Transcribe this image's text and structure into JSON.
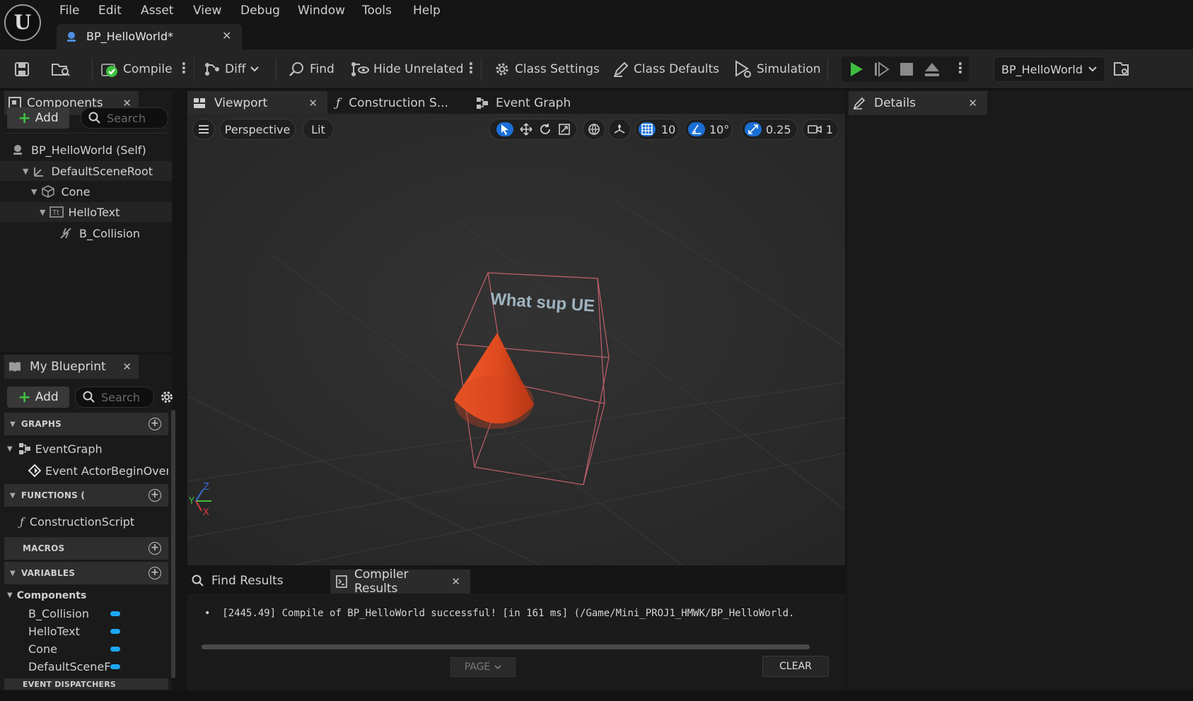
{
  "menu": {
    "items": [
      "File",
      "Edit",
      "Asset",
      "View",
      "Debug",
      "Window",
      "Tools",
      "Help"
    ]
  },
  "document_tab": {
    "title": "BP_HelloWorld*"
  },
  "toolbar": {
    "compile": "Compile",
    "diff": "Diff",
    "find": "Find",
    "hide_unrelated": "Hide Unrelated",
    "class_settings": "Class Settings",
    "class_defaults": "Class Defaults",
    "simulation": "Simulation",
    "debug_object": "BP_HelloWorld"
  },
  "components_panel": {
    "title": "Components",
    "add_label": "Add",
    "search_placeholder": "Search",
    "tree": [
      {
        "label": "BP_HelloWorld (Self)",
        "icon": "actor-icon"
      },
      {
        "label": "DefaultSceneRoot",
        "icon": "scene-root-icon"
      },
      {
        "label": "Cone",
        "icon": "mesh-icon"
      },
      {
        "label": "HelloText",
        "icon": "text-render-icon"
      },
      {
        "label": "B_Collision",
        "icon": "collision-icon"
      }
    ]
  },
  "my_blueprint": {
    "title": "My Blueprint",
    "add_label": "Add",
    "search_placeholder": "Search",
    "graphs_header": "GRAPHS",
    "event_graph": "EventGraph",
    "event_item": "Event ActorBeginOver",
    "functions_header": "FUNCTIONS (",
    "construction_script": "ConstructionScript",
    "macros_header": "MACROS",
    "variables_header": "VARIABLES",
    "components_header": "Components",
    "variables": [
      "B_Collision",
      "HelloText",
      "Cone",
      "DefaultSceneF"
    ],
    "dispatchers_header": "EVENT DISPATCHERS"
  },
  "editor_tabs": {
    "viewport": "Viewport",
    "construction": "Construction S...",
    "event_graph": "Event Graph"
  },
  "viewport": {
    "perspective": "Perspective",
    "lit": "Lit",
    "grid_snap": "10",
    "rot_snap": "10°",
    "scale_snap": "0.25",
    "camera_speed": "1",
    "text_render": "What sup UE",
    "axis_labels": {
      "y": "Y",
      "z": "Z",
      "x": "X"
    }
  },
  "output": {
    "find_results": "Find Results",
    "compiler_results": "Compiler Results",
    "log_line": "[2445.49] Compile of BP_HelloWorld successful! [in 161 ms] (/Game/Mini_PROJ1_HMWK/BP_HelloWorld.",
    "page_label": "PAGE",
    "clear_label": "CLEAR"
  },
  "details": {
    "title": "Details"
  },
  "colors": {
    "accent_blue": "#1a6fd6",
    "play_green": "#3fbf3f",
    "cone_orange": "#e04a1f",
    "variable_pill": "#1ea7f5"
  }
}
